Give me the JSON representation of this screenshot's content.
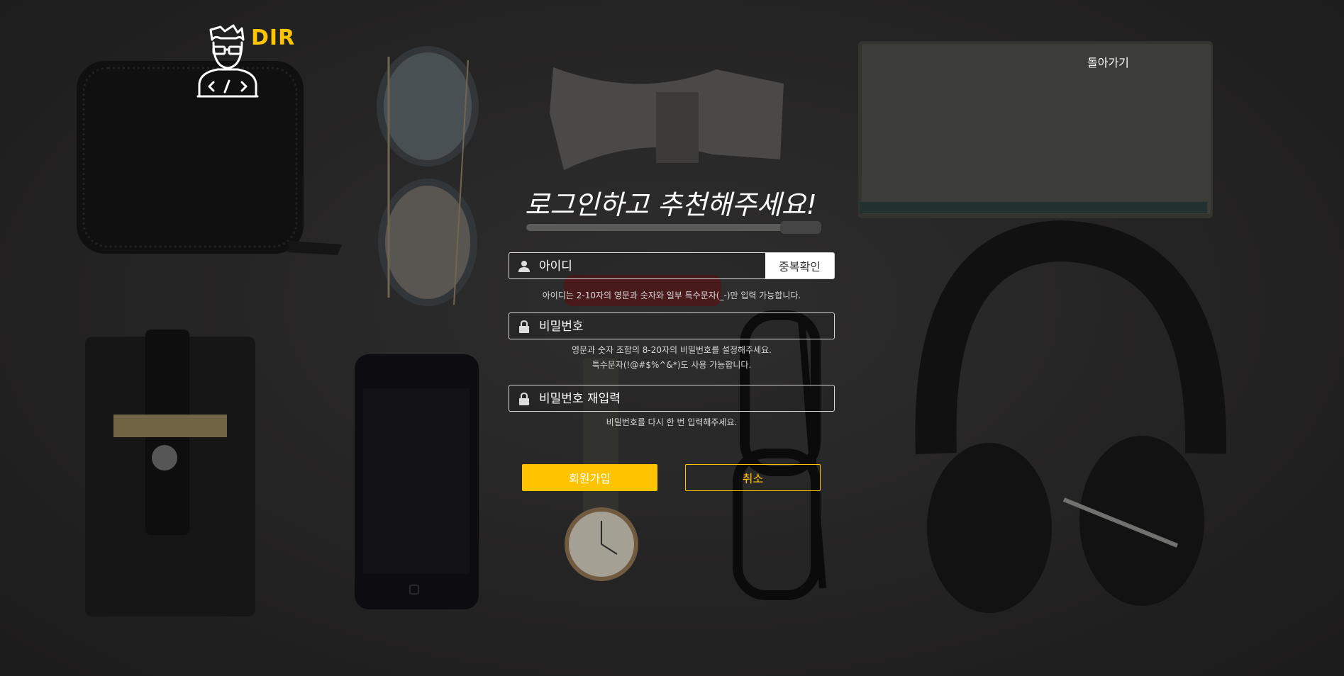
{
  "brand": {
    "name": "DIR",
    "logo_icon": "developer-avatar-icon",
    "accent_color": "#ffc300"
  },
  "nav": {
    "back_label": "돌아가기"
  },
  "form": {
    "title": "로그인하고 추천해주세요!",
    "id_field": {
      "placeholder": "아이디",
      "icon": "user-icon"
    },
    "dup_check_label": "중복확인",
    "id_hint": "아이디는 2-10자의 영문과 숫자와 일부 특수문자(_-)만 입력 가능합니다.",
    "password_field": {
      "placeholder": "비밀번호",
      "icon": "lock-icon"
    },
    "password_hint_1": "영문과 숫자 조합의 8-20자의 비밀번호를 설정해주세요.",
    "password_hint_2": "특수문자(!@#$%^&*)도 사용 가능합니다.",
    "password_confirm_field": {
      "placeholder": "비밀번호 재입력",
      "icon": "lock-icon"
    },
    "password_confirm_hint": "비밀번호를 다시 한 번 입력해주세요.",
    "signup_label": "회원가입",
    "cancel_label": "취소"
  }
}
